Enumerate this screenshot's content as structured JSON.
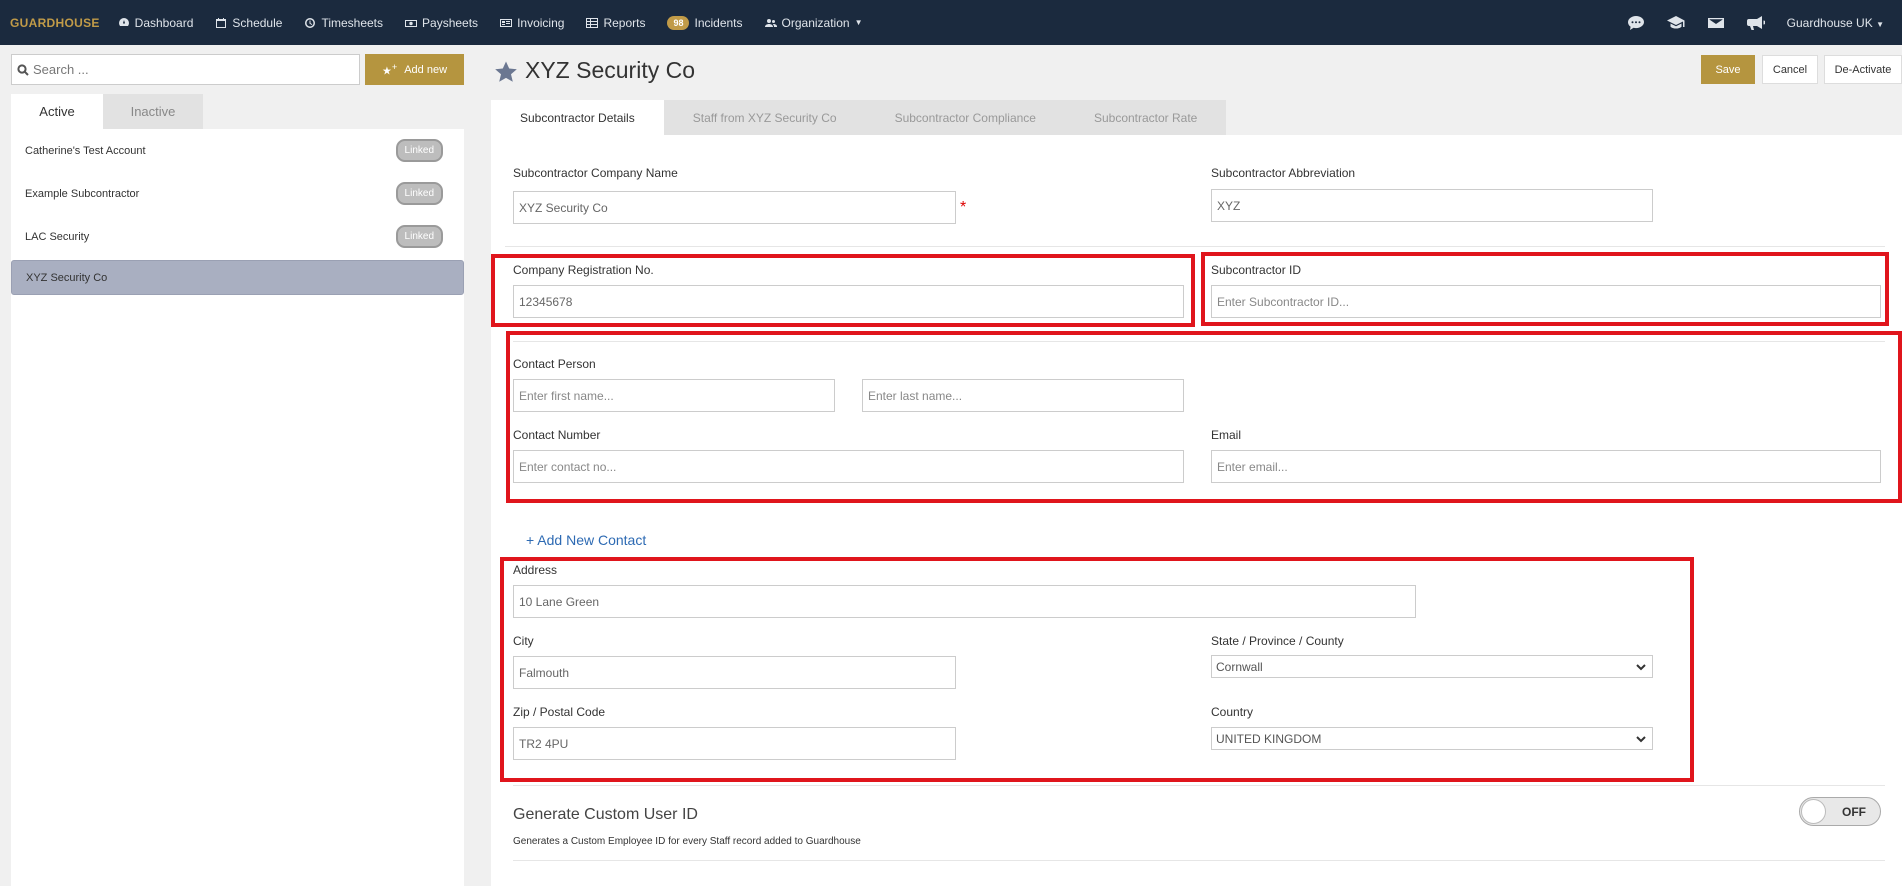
{
  "nav": {
    "brand": "GUARDHOUSE",
    "items": [
      {
        "label": "Dashboard",
        "icon": "dashboard-icon"
      },
      {
        "label": "Schedule",
        "icon": "calendar-icon"
      },
      {
        "label": "Timesheets",
        "icon": "clock-icon"
      },
      {
        "label": "Paysheets",
        "icon": "money-icon"
      },
      {
        "label": "Invoicing",
        "icon": "invoice-icon"
      },
      {
        "label": "Reports",
        "icon": "table-icon"
      }
    ],
    "incidents_badge": "98",
    "incidents_label": "Incidents",
    "organization_label": "Organization",
    "user": "Guardhouse UK"
  },
  "sidebar": {
    "search_placeholder": "Search ...",
    "add_new": "Add new",
    "tabs": [
      "Active",
      "Inactive"
    ],
    "items": [
      {
        "name": "Catherine's Test Account",
        "badge": "Linked"
      },
      {
        "name": "Example Subcontractor",
        "badge": "Linked"
      },
      {
        "name": "LAC Security",
        "badge": "Linked"
      },
      {
        "name": "XYZ Security Co",
        "badge": ""
      }
    ]
  },
  "header": {
    "title": "XYZ Security Co",
    "save": "Save",
    "cancel": "Cancel",
    "deactivate": "De-Activate"
  },
  "tabs": [
    "Subcontractor Details",
    "Staff from XYZ Security Co",
    "Subcontractor Compliance",
    "Subcontractor Rate"
  ],
  "form": {
    "company_name_label": "Subcontractor Company Name",
    "company_name_value": "XYZ Security Co",
    "abbreviation_label": "Subcontractor Abbreviation",
    "abbreviation_value": "XYZ",
    "reg_no_label": "Company Registration No.",
    "reg_no_value": "12345678",
    "sub_id_label": "Subcontractor ID",
    "sub_id_placeholder": "Enter Subcontractor ID...",
    "contact_person_label": "Contact Person",
    "first_name_placeholder": "Enter first name...",
    "last_name_placeholder": "Enter last name...",
    "contact_number_label": "Contact Number",
    "contact_number_placeholder": "Enter contact no...",
    "email_label": "Email",
    "email_placeholder": "Enter email...",
    "add_contact": "+ Add New Contact",
    "address_label": "Address",
    "address_value": "10 Lane Green",
    "city_label": "City",
    "city_value": "Falmouth",
    "state_label": "State / Province / County",
    "state_value": "Cornwall",
    "zip_label": "Zip / Postal Code",
    "zip_value": "TR2 4PU",
    "country_label": "Country",
    "country_value": "UNITED KINGDOM",
    "custom_id_title": "Generate Custom User ID",
    "custom_id_desc": "Generates a Custom Employee ID for every Staff record added to Guardhouse",
    "toggle_state": "OFF"
  }
}
